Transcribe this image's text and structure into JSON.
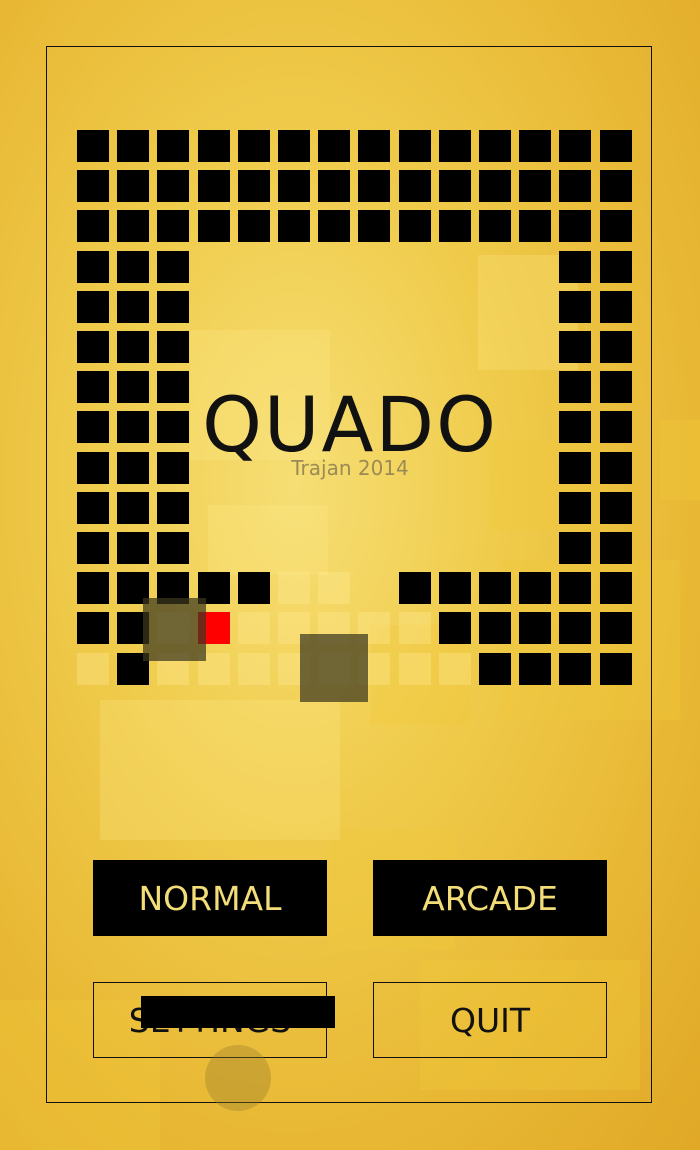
{
  "game": {
    "title": "QUADO",
    "subtitle": "Trajan 2014"
  },
  "menu": {
    "normal_label": "NORMAL",
    "arcade_label": "ARCADE",
    "settings_label": "SETTINGS",
    "quit_label": "QUIT"
  },
  "colors": {
    "background": "#f0cc4c",
    "block": "#000000",
    "player": "#ff0000",
    "button_text": "#f3dd78"
  }
}
